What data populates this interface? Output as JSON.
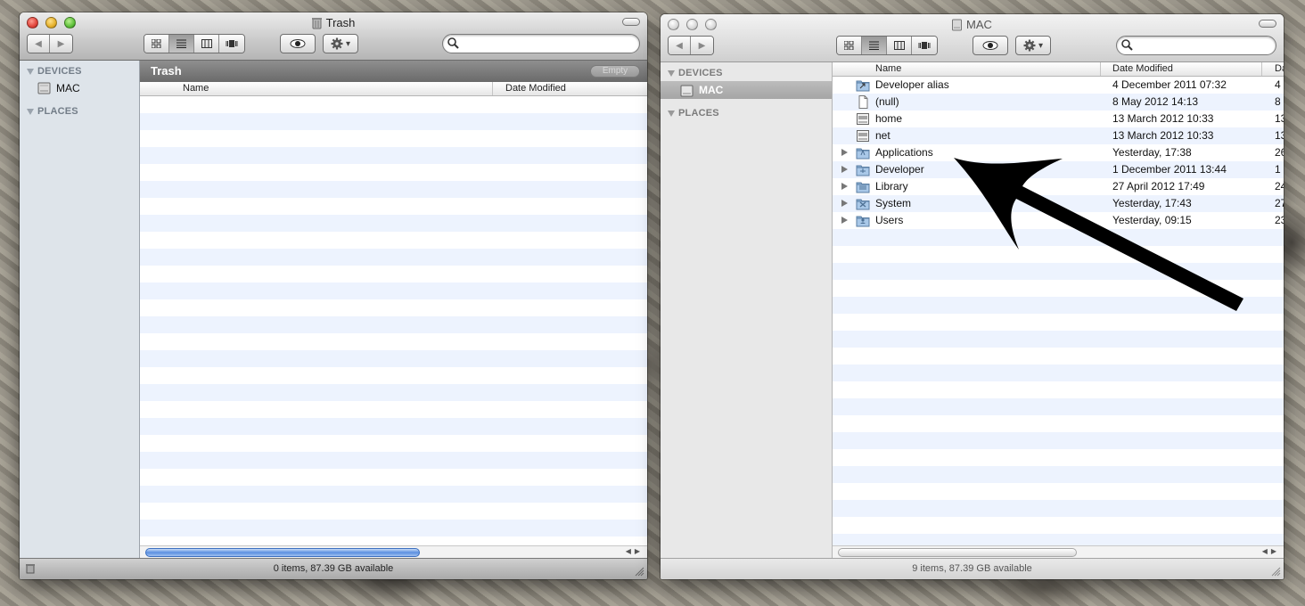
{
  "trash_window": {
    "title": "Trash",
    "path_title": "Trash",
    "empty_label": "Empty",
    "columns": [
      "Name",
      "Date Modified"
    ],
    "sidebar": {
      "devices_header": "DEVICES",
      "device_item": "MAC",
      "places_header": "PLACES"
    },
    "status": "0 items, 87.39 GB available",
    "search_placeholder": ""
  },
  "mac_window": {
    "title": "MAC",
    "columns": [
      "Name",
      "Date Modified",
      "Da"
    ],
    "sidebar": {
      "devices_header": "DEVICES",
      "device_item": "MAC",
      "places_header": "PLACES"
    },
    "rows": [
      {
        "name": "Developer alias",
        "date": "4 December 2011 07:32",
        "kind_cut": "4",
        "icon": "alias-folder-icon",
        "expandable": false
      },
      {
        "name": "(null)",
        "date": "8 May 2012 14:13",
        "kind_cut": "8",
        "icon": "document-icon",
        "expandable": false
      },
      {
        "name": "home",
        "date": "13 March 2012 10:33",
        "kind_cut": "13",
        "icon": "server-icon",
        "expandable": false
      },
      {
        "name": "net",
        "date": "13 March 2012 10:33",
        "kind_cut": "13",
        "icon": "server-icon",
        "expandable": false
      },
      {
        "name": "Applications",
        "date": "Yesterday, 17:38",
        "kind_cut": "26",
        "icon": "applications-folder-icon",
        "expandable": true
      },
      {
        "name": "Developer",
        "date": "1 December 2011 13:44",
        "kind_cut": "1",
        "icon": "developer-folder-icon",
        "expandable": true
      },
      {
        "name": "Library",
        "date": "27 April 2012 17:49",
        "kind_cut": "24",
        "icon": "library-folder-icon",
        "expandable": true
      },
      {
        "name": "System",
        "date": "Yesterday, 17:43",
        "kind_cut": "27",
        "icon": "system-folder-icon",
        "expandable": true
      },
      {
        "name": "Users",
        "date": "Yesterday, 09:15",
        "kind_cut": "23",
        "icon": "users-folder-icon",
        "expandable": true
      }
    ],
    "status": "9 items, 87.39 GB available",
    "search_placeholder": ""
  },
  "colors": {
    "stripe": "#edf3fe",
    "sidebar_blue": "#dee4ea",
    "annotation_arrow": "#000000"
  }
}
